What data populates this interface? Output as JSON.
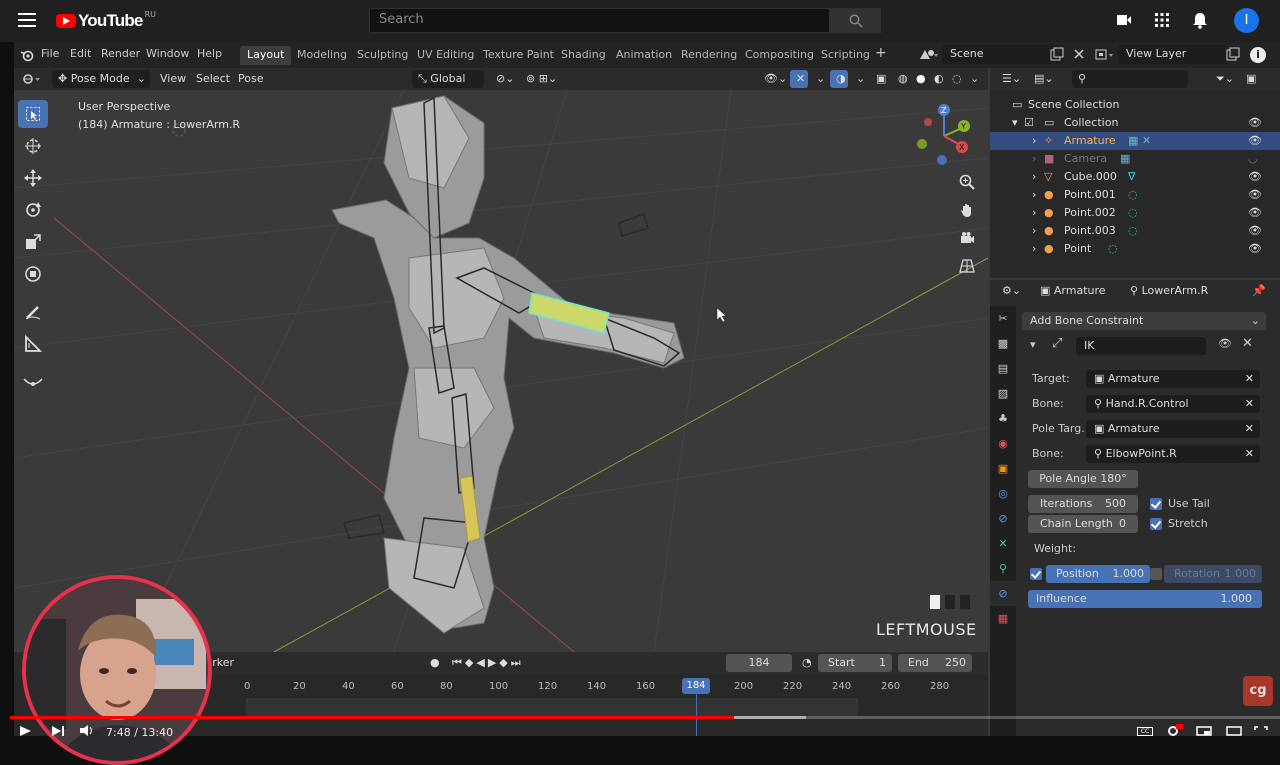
{
  "youtube": {
    "logo_text": "YouTube",
    "region": "RU",
    "search_placeholder": "Search",
    "avatar_letter": "I",
    "time_current": "7:48",
    "time_total": "13:40",
    "progress_fraction": 0.57
  },
  "blender": {
    "menu": [
      "File",
      "Edit",
      "Render",
      "Window",
      "Help"
    ],
    "workspaces": [
      "Layout",
      "Modeling",
      "Sculpting",
      "UV Editing",
      "Texture Paint",
      "Shading",
      "Animation",
      "Rendering",
      "Compositing",
      "Scripting"
    ],
    "active_workspace": "Layout",
    "scene": "Scene",
    "view_layer": "View Layer",
    "viewport": {
      "mode": "Pose Mode",
      "view": "View",
      "select": "Select",
      "pose": "Pose",
      "transform_orientation": "Global",
      "info_line1": "User Perspective",
      "info_line2": "(184) Armature : LowerArm.R",
      "status": "LEFTMOUSE",
      "gizmo_x": "X",
      "gizmo_y": "Y",
      "gizmo_z": "Z"
    },
    "outliner": {
      "root": "Scene Collection",
      "collection": "Collection",
      "items": [
        "Armature",
        "Camera",
        "Cube.000",
        "Point.001",
        "Point.002",
        "Point.003",
        "Point"
      ]
    },
    "properties": {
      "breadcrumb_object": "Armature",
      "breadcrumb_bone": "LowerArm.R",
      "add_constraint": "Add Bone Constraint",
      "constraint_name": "IK",
      "target_label": "Target:",
      "target_value": "Armature",
      "bone_label": "Bone:",
      "bone_value": "Hand.R.Control",
      "pole_target_label": "Pole Targ...",
      "pole_target_value": "Armature",
      "pole_bone_label": "Bone:",
      "pole_bone_value": "ElbowPoint.R",
      "pole_angle_label": "Pole Angle",
      "pole_angle_value": "180°",
      "iterations_label": "Iterations",
      "iterations_value": "500",
      "chain_length_label": "Chain Length",
      "chain_length_value": "0",
      "use_tail": "Use Tail",
      "stretch": "Stretch",
      "weight_label": "Weight:",
      "position_label": "Position",
      "position_value": "1.000",
      "rotation_label": "Rotation",
      "rotation_value": "1.000",
      "influence_label": "Influence",
      "influence_value": "1.000"
    },
    "timeline": {
      "marker": "Marker",
      "current_frame": "184",
      "start_label": "Start",
      "start_value": "1",
      "end_label": "End",
      "end_value": "250",
      "ticks": [
        "0",
        "20",
        "40",
        "60",
        "80",
        "100",
        "120",
        "140",
        "160",
        "200",
        "220",
        "240",
        "260",
        "280"
      ]
    }
  },
  "colors": {
    "accent": "#4772b3",
    "selection": "#334d80",
    "yt_red": "#ff0000",
    "bone_highlight": "#cdd86a"
  }
}
